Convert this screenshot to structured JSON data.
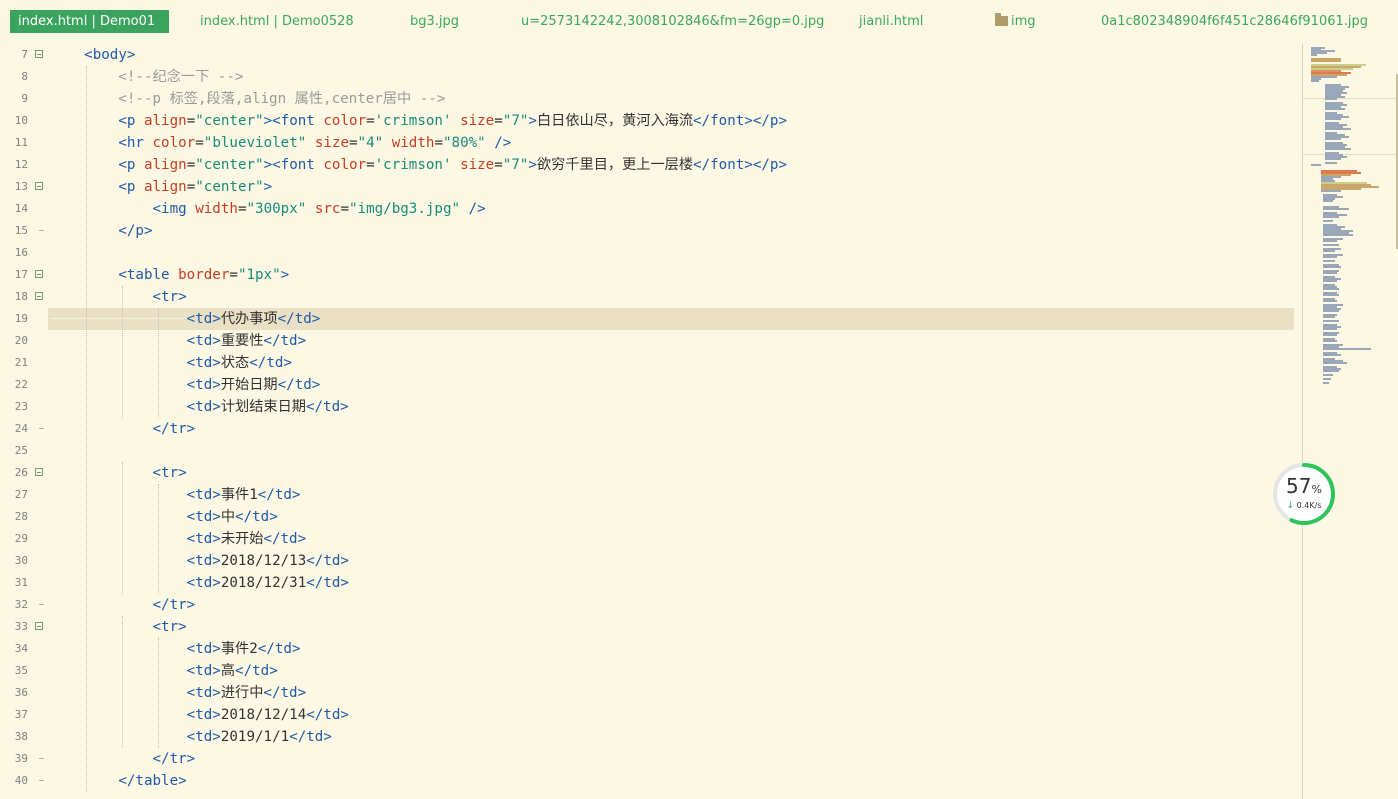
{
  "tabs": [
    {
      "label": "index.html | Demo01",
      "active": true
    },
    {
      "label": "index.html | Demo0528",
      "active": false
    },
    {
      "label": "bg3.jpg",
      "active": false
    },
    {
      "label": "u=2573142242,3008102846&fm=26gp=0.jpg",
      "active": false
    },
    {
      "label": "jianli.html",
      "active": false
    },
    {
      "label": "img",
      "active": false,
      "icon": "folder-icon"
    },
    {
      "label": "0a1c802348904f6f451c28646f91061.jpg",
      "active": false
    }
  ],
  "editor": {
    "current_line": 19,
    "lines": [
      {
        "n": "7",
        "fold": "open",
        "tokens": [
          [
            "t",
            "    "
          ],
          [
            "tag",
            "<body>"
          ]
        ]
      },
      {
        "n": "8",
        "fold": "",
        "tokens": [
          [
            "t",
            "        "
          ],
          [
            "cmt",
            "<!--纪念一下 -->"
          ]
        ]
      },
      {
        "n": "9",
        "fold": "",
        "tokens": [
          [
            "t",
            "        "
          ],
          [
            "cmt",
            "<!--p 标签,段落,align 属性,center居中 -->"
          ]
        ]
      },
      {
        "n": "10",
        "fold": "",
        "tokens": [
          [
            "t",
            "        "
          ],
          [
            "tag",
            "<p "
          ],
          [
            "attr",
            "align"
          ],
          [
            "t",
            "="
          ],
          [
            "str",
            "\"center\""
          ],
          [
            "tag",
            "><font "
          ],
          [
            "attr",
            "color"
          ],
          [
            "t",
            "="
          ],
          [
            "str",
            "'crimson'"
          ],
          [
            "t",
            " "
          ],
          [
            "attr",
            "size"
          ],
          [
            "t",
            "="
          ],
          [
            "str",
            "\"7\""
          ],
          [
            "tag",
            ">"
          ],
          [
            "t",
            "白日依山尽，黄河入海流"
          ],
          [
            "tag",
            "</font></p>"
          ]
        ]
      },
      {
        "n": "11",
        "fold": "",
        "tokens": [
          [
            "t",
            "        "
          ],
          [
            "tag",
            "<hr "
          ],
          [
            "attr",
            "color"
          ],
          [
            "t",
            "="
          ],
          [
            "str",
            "\"blueviolet\""
          ],
          [
            "t",
            " "
          ],
          [
            "attr",
            "size"
          ],
          [
            "t",
            "="
          ],
          [
            "str",
            "\"4\""
          ],
          [
            "t",
            " "
          ],
          [
            "attr",
            "width"
          ],
          [
            "t",
            "="
          ],
          [
            "str",
            "\"80%\""
          ],
          [
            "tag",
            " />"
          ]
        ]
      },
      {
        "n": "12",
        "fold": "",
        "tokens": [
          [
            "t",
            "        "
          ],
          [
            "tag",
            "<p "
          ],
          [
            "attr",
            "align"
          ],
          [
            "t",
            "="
          ],
          [
            "str",
            "\"center\""
          ],
          [
            "tag",
            "><font "
          ],
          [
            "attr",
            "color"
          ],
          [
            "t",
            "="
          ],
          [
            "str",
            "'crimson'"
          ],
          [
            "t",
            " "
          ],
          [
            "attr",
            "size"
          ],
          [
            "t",
            "="
          ],
          [
            "str",
            "\"7\""
          ],
          [
            "tag",
            ">"
          ],
          [
            "t",
            "欲穷千里目，更上一层楼"
          ],
          [
            "tag",
            "</font></p>"
          ]
        ]
      },
      {
        "n": "13",
        "fold": "open",
        "tokens": [
          [
            "t",
            "        "
          ],
          [
            "tag",
            "<p "
          ],
          [
            "attr",
            "align"
          ],
          [
            "t",
            "="
          ],
          [
            "str",
            "\"center\""
          ],
          [
            "tag",
            ">"
          ]
        ]
      },
      {
        "n": "14",
        "fold": "",
        "tokens": [
          [
            "t",
            "            "
          ],
          [
            "tag",
            "<img "
          ],
          [
            "attr",
            "width"
          ],
          [
            "t",
            "="
          ],
          [
            "str",
            "\"300px\""
          ],
          [
            "t",
            " "
          ],
          [
            "attr",
            "src"
          ],
          [
            "t",
            "="
          ],
          [
            "str",
            "\"img/bg3.jpg\""
          ],
          [
            "tag",
            " />"
          ]
        ]
      },
      {
        "n": "15",
        "fold": "end",
        "tokens": [
          [
            "t",
            "        "
          ],
          [
            "tag",
            "</p>"
          ]
        ]
      },
      {
        "n": "16",
        "fold": "",
        "tokens": []
      },
      {
        "n": "17",
        "fold": "open",
        "tokens": [
          [
            "t",
            "        "
          ],
          [
            "tag",
            "<table "
          ],
          [
            "attr",
            "border"
          ],
          [
            "t",
            "="
          ],
          [
            "str",
            "\"1px\""
          ],
          [
            "tag",
            ">"
          ]
        ]
      },
      {
        "n": "18",
        "fold": "open",
        "tokens": [
          [
            "t",
            "            "
          ],
          [
            "tag",
            "<tr>"
          ]
        ]
      },
      {
        "n": "19",
        "fold": "",
        "tokens": [
          [
            "t",
            "                "
          ],
          [
            "tag",
            "<td>"
          ],
          [
            "t",
            "代办事项"
          ],
          [
            "tag",
            "</td>"
          ]
        ]
      },
      {
        "n": "20",
        "fold": "",
        "tokens": [
          [
            "t",
            "                "
          ],
          [
            "tag",
            "<td>"
          ],
          [
            "t",
            "重要性"
          ],
          [
            "tag",
            "</td>"
          ]
        ]
      },
      {
        "n": "21",
        "fold": "",
        "tokens": [
          [
            "t",
            "                "
          ],
          [
            "tag",
            "<td>"
          ],
          [
            "t",
            "状态"
          ],
          [
            "tag",
            "</td>"
          ]
        ]
      },
      {
        "n": "22",
        "fold": "",
        "tokens": [
          [
            "t",
            "                "
          ],
          [
            "tag",
            "<td>"
          ],
          [
            "t",
            "开始日期"
          ],
          [
            "tag",
            "</td>"
          ]
        ]
      },
      {
        "n": "23",
        "fold": "",
        "tokens": [
          [
            "t",
            "                "
          ],
          [
            "tag",
            "<td>"
          ],
          [
            "t",
            "计划结束日期"
          ],
          [
            "tag",
            "</td>"
          ]
        ]
      },
      {
        "n": "24",
        "fold": "end",
        "tokens": [
          [
            "t",
            "            "
          ],
          [
            "tag",
            "</tr>"
          ]
        ]
      },
      {
        "n": "25",
        "fold": "",
        "tokens": []
      },
      {
        "n": "26",
        "fold": "open",
        "tokens": [
          [
            "t",
            "            "
          ],
          [
            "tag",
            "<tr>"
          ]
        ]
      },
      {
        "n": "27",
        "fold": "",
        "tokens": [
          [
            "t",
            "                "
          ],
          [
            "tag",
            "<td>"
          ],
          [
            "t",
            "事件1"
          ],
          [
            "tag",
            "</td>"
          ]
        ]
      },
      {
        "n": "28",
        "fold": "",
        "tokens": [
          [
            "t",
            "                "
          ],
          [
            "tag",
            "<td>"
          ],
          [
            "t",
            "中"
          ],
          [
            "tag",
            "</td>"
          ]
        ]
      },
      {
        "n": "29",
        "fold": "",
        "tokens": [
          [
            "t",
            "                "
          ],
          [
            "tag",
            "<td>"
          ],
          [
            "t",
            "未开始"
          ],
          [
            "tag",
            "</td>"
          ]
        ]
      },
      {
        "n": "30",
        "fold": "",
        "tokens": [
          [
            "t",
            "                "
          ],
          [
            "tag",
            "<td>"
          ],
          [
            "t",
            "2018/12/13"
          ],
          [
            "tag",
            "</td>"
          ]
        ]
      },
      {
        "n": "31",
        "fold": "",
        "tokens": [
          [
            "t",
            "                "
          ],
          [
            "tag",
            "<td>"
          ],
          [
            "t",
            "2018/12/31"
          ],
          [
            "tag",
            "</td>"
          ]
        ]
      },
      {
        "n": "32",
        "fold": "end",
        "tokens": [
          [
            "t",
            "            "
          ],
          [
            "tag",
            "</tr>"
          ]
        ]
      },
      {
        "n": "33",
        "fold": "open",
        "tokens": [
          [
            "t",
            "            "
          ],
          [
            "tag",
            "<tr>"
          ]
        ]
      },
      {
        "n": "34",
        "fold": "",
        "tokens": [
          [
            "t",
            "                "
          ],
          [
            "tag",
            "<td>"
          ],
          [
            "t",
            "事件2"
          ],
          [
            "tag",
            "</td>"
          ]
        ]
      },
      {
        "n": "35",
        "fold": "",
        "tokens": [
          [
            "t",
            "                "
          ],
          [
            "tag",
            "<td>"
          ],
          [
            "t",
            "高"
          ],
          [
            "tag",
            "</td>"
          ]
        ]
      },
      {
        "n": "36",
        "fold": "",
        "tokens": [
          [
            "t",
            "                "
          ],
          [
            "tag",
            "<td>"
          ],
          [
            "t",
            "进行中"
          ],
          [
            "tag",
            "</td>"
          ]
        ]
      },
      {
        "n": "37",
        "fold": "",
        "tokens": [
          [
            "t",
            "                "
          ],
          [
            "tag",
            "<td>"
          ],
          [
            "t",
            "2018/12/14"
          ],
          [
            "tag",
            "</td>"
          ]
        ]
      },
      {
        "n": "38",
        "fold": "",
        "tokens": [
          [
            "t",
            "                "
          ],
          [
            "tag",
            "<td>"
          ],
          [
            "t",
            "2019/1/1"
          ],
          [
            "tag",
            "</td>"
          ]
        ]
      },
      {
        "n": "39",
        "fold": "end",
        "tokens": [
          [
            "t",
            "            "
          ],
          [
            "tag",
            "</tr>"
          ]
        ]
      },
      {
        "n": "40",
        "fold": "end",
        "tokens": [
          [
            "t",
            "        "
          ],
          [
            "tag",
            "</table>"
          ]
        ]
      }
    ]
  },
  "net_widget": {
    "percent": "57",
    "percent_unit": "%",
    "speed": "0.4K/s",
    "progress": 0.57,
    "ring_color": "#2fc45a"
  },
  "colors": {
    "background": "#fdf8e4",
    "tab_active": "#3aa35d",
    "tag": "#1e5aa8",
    "attribute": "#c63d1f",
    "string": "#1a8a7a",
    "comment": "#9a9a9a",
    "current_line": "#e9e0c5"
  }
}
